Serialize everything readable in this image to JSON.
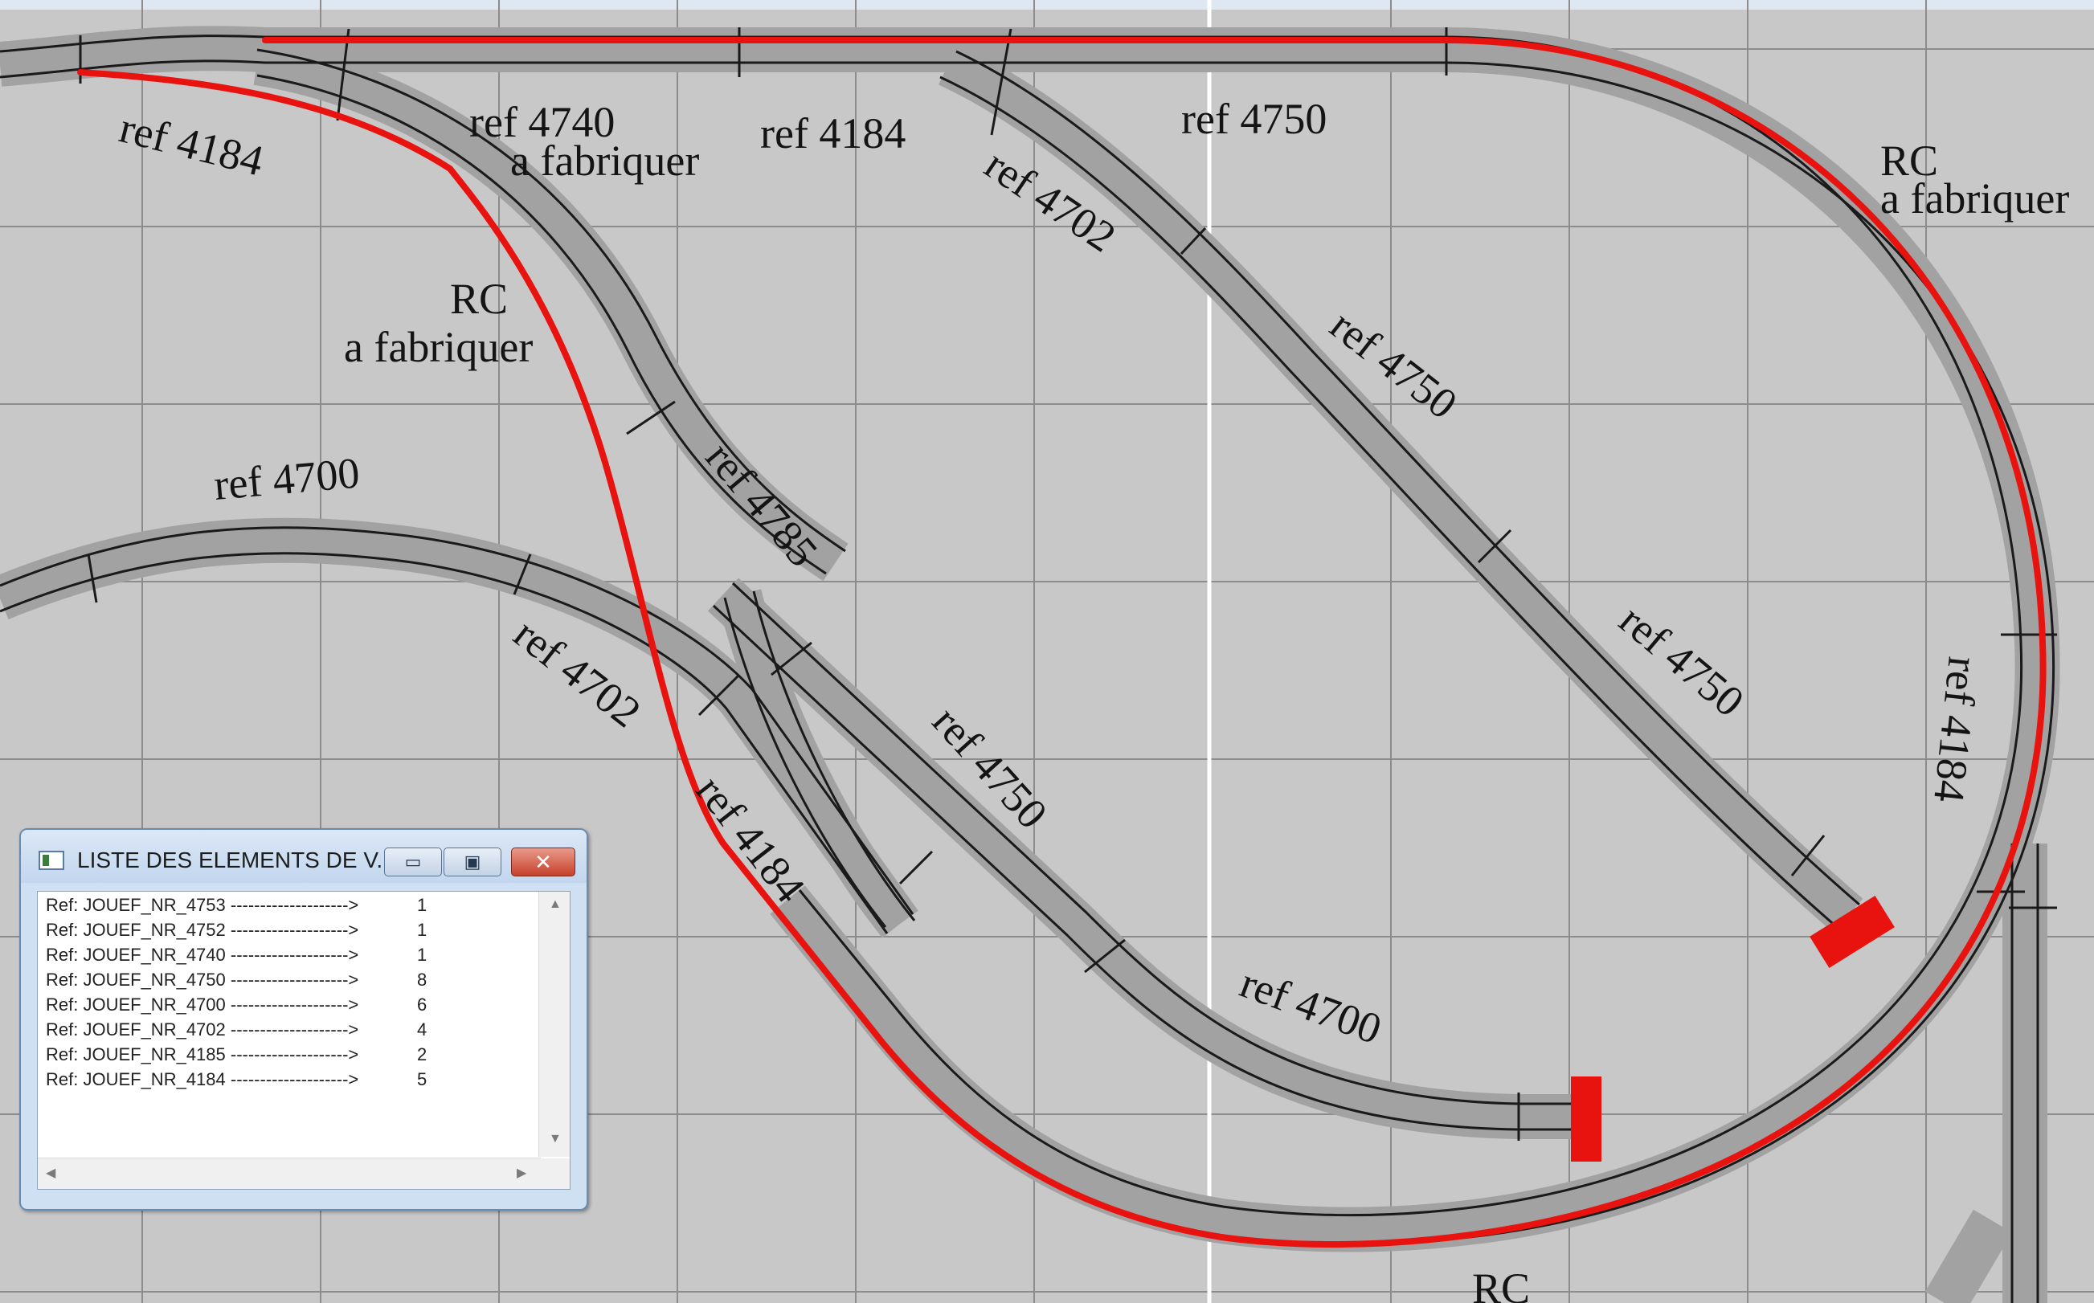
{
  "labels": {
    "t1": "ref 4184",
    "t2": "ref 4740",
    "t3": "a fabriquer",
    "t4": "ref 4184",
    "t5": "ref 4750",
    "t6": "ref 4702",
    "t7": "RC",
    "t8": "a fabriquer",
    "t9": "RC",
    "t10": "a fabriquer",
    "t11": "ref 4750",
    "t12": "ref 4700",
    "t13": "ref 4785",
    "t14": "ref 4702",
    "t15": "ref 4750",
    "t16": "ref 4750",
    "t17": "ref 4184",
    "t18": "ref 4184",
    "t19": "ref 4700",
    "t20": "RC"
  },
  "window": {
    "title": "LISTE DES ELEMENTS DE V...",
    "min_symbol": "▭",
    "max_symbol": "▣",
    "close_symbol": "✕",
    "rows": [
      {
        "ref": "Ref: JOUEF_NR_4753 -------------------->",
        "count": "1"
      },
      {
        "ref": "Ref: JOUEF_NR_4752 -------------------->",
        "count": "1"
      },
      {
        "ref": "Ref: JOUEF_NR_4740 -------------------->",
        "count": "1"
      },
      {
        "ref": "Ref: JOUEF_NR_4750 -------------------->",
        "count": "8"
      },
      {
        "ref": "Ref: JOUEF_NR_4700 -------------------->",
        "count": "6"
      },
      {
        "ref": "Ref: JOUEF_NR_4702 -------------------->",
        "count": "4"
      },
      {
        "ref": "Ref: JOUEF_NR_4185 -------------------->",
        "count": "2"
      },
      {
        "ref": "Ref: JOUEF_NR_4184 -------------------->",
        "count": "5"
      }
    ]
  },
  "colors": {
    "background": "#c8c8c8",
    "grid": "#8c8c8c",
    "track_bed": "#a2a2a2",
    "rail": "#1a1a1a",
    "highlight": "#e8130f",
    "buffer_stop": "#e8130f"
  }
}
